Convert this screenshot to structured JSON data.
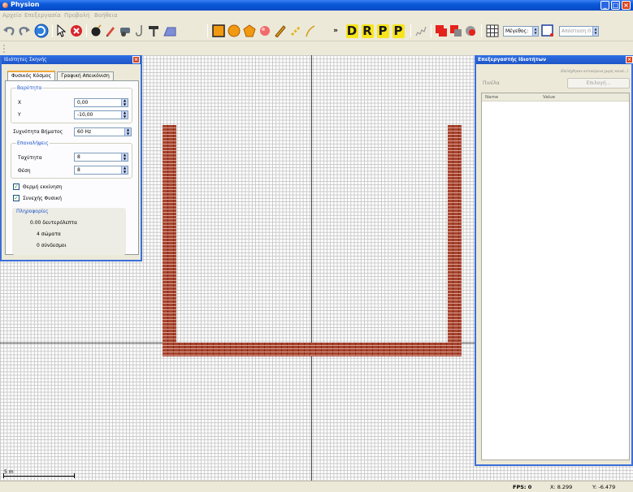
{
  "window": {
    "title": "Physion"
  },
  "menu": [
    "Αρχείο",
    "Επεξεργασία",
    "Προβολή",
    "Βοήθεια"
  ],
  "toolbar": {
    "tools": [
      "undo-icon",
      "redo-icon",
      "play-icon",
      "pointer-icon",
      "stop-icon",
      "bomb-icon",
      "eraser-icon",
      "cannon-icon",
      "hook-icon",
      "nail-icon",
      "ramp-icon"
    ],
    "shapes": [
      "square-icon",
      "circle-icon",
      "pentagon-icon",
      "ball-icon",
      "pencil-icon",
      "chain-icon",
      "rope-icon"
    ],
    "joints": [
      "D",
      "R",
      "P",
      "P"
    ],
    "size_value": "Μέγεθος:",
    "distance_value": "Απόσταση:0.2"
  },
  "colors": {
    "brick": "#a9442f",
    "dock_header": "#2e6fe4",
    "grid": "#c8c8c8"
  },
  "scene_properties": {
    "title": "Ιδιότητες Σκηνής",
    "tabs": [
      "Φυσικός Κόσμος",
      "Γραφική Απεικόνιση"
    ],
    "gravity": {
      "title": "Βαρύτητα",
      "x_label": "X",
      "x_value": "0,00",
      "y_label": "Y",
      "y_value": "-10,00"
    },
    "step_freq": {
      "label": "Συχνότητα Βήματος",
      "value": "60 Hz"
    },
    "iterations": {
      "title": "Επαναλήψεις",
      "velocity_label": "Ταχύτητα",
      "velocity_value": "8",
      "position_label": "Θέση",
      "position_value": "8"
    },
    "warm_start": "Θερμή εκκίνηση",
    "continuous": "Συνεχής Φυσική",
    "info": {
      "title": "Πληροφορίες",
      "time": "0.00  δευτερόλεπτα",
      "bodies": "4  σώματα",
      "joints": "0  σύνδεσμοι"
    }
  },
  "property_editor": {
    "title": "Επεξεργαστής Ιδιοτήτων",
    "hint": "(Επιλέχθηκαν αντικείμενα χωρίς κοινά...)",
    "panel_label": "Πινέλα",
    "select_button": "Επιλογή...",
    "columns": [
      "Name",
      "Value"
    ]
  },
  "scale_label": "5 m",
  "status": {
    "fps": "FPS: 0",
    "x": "X:  8.299",
    "y": "Y:  -6.479"
  }
}
